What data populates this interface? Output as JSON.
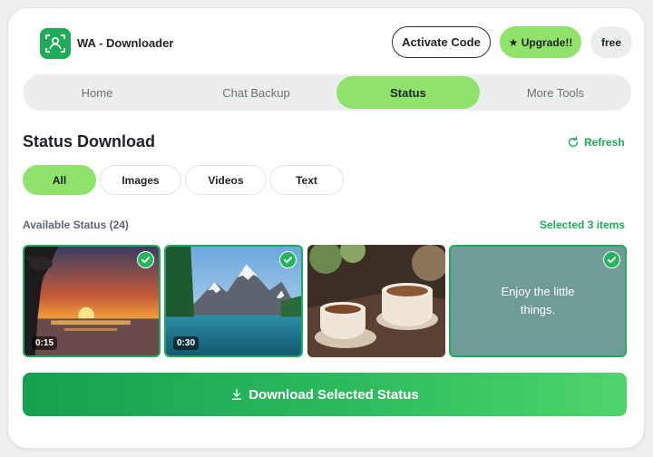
{
  "app": {
    "title": "WA - Downloader",
    "icon": "face-scan-icon",
    "brand_color": "#1faa5a"
  },
  "header": {
    "activate_label": "Activate Code",
    "upgrade_label": "★ Upgrade!!",
    "plan_badge": "free"
  },
  "nav": {
    "tabs": [
      {
        "label": "Home",
        "active": false
      },
      {
        "label": "Chat Backup",
        "active": false
      },
      {
        "label": "Status",
        "active": true
      },
      {
        "label": "More Tools",
        "active": false
      }
    ]
  },
  "status": {
    "title": "Status Download",
    "refresh_label": "Refresh",
    "filters": [
      {
        "label": "All",
        "active": true
      },
      {
        "label": "Images",
        "active": false
      },
      {
        "label": "Videos",
        "active": false
      },
      {
        "label": "Text",
        "active": false
      }
    ],
    "available_label": "Available Status (24)",
    "selected_label": "Selected 3 items",
    "items": [
      {
        "kind": "video",
        "scene": "sunset over lake",
        "duration": "0:15",
        "selected": true
      },
      {
        "kind": "video",
        "scene": "mountain lake",
        "duration": "0:30",
        "selected": true
      },
      {
        "kind": "image",
        "scene": "coffee cups",
        "selected": false
      },
      {
        "kind": "text",
        "text": "Enjoy the little things.",
        "selected": true
      }
    ],
    "download_label": "Download Selected Status"
  },
  "colors": {
    "accent": "#8fe26a",
    "primary": "#1faa5a",
    "text_tile": "#6f9c97"
  }
}
